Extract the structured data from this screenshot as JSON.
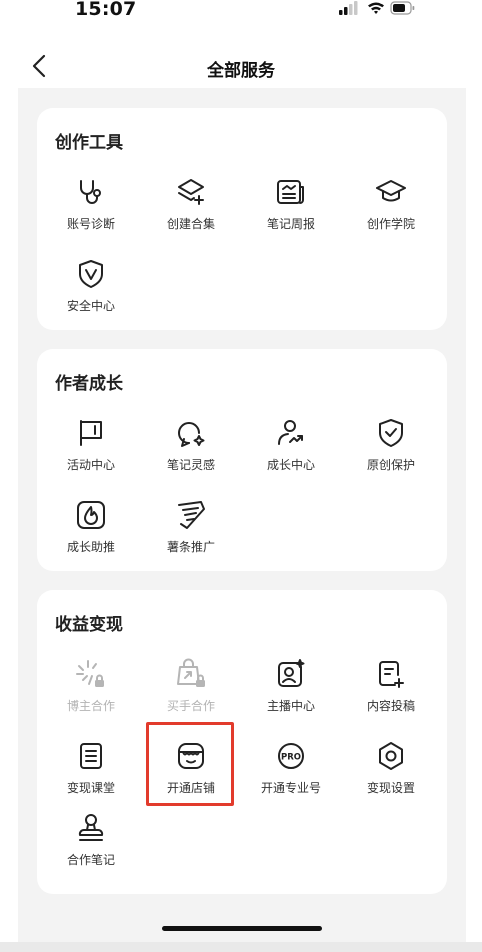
{
  "status_bar": {
    "time": "15:07"
  },
  "nav": {
    "title": "全部服务"
  },
  "sections": [
    {
      "title": "创作工具",
      "items": [
        {
          "label": "账号诊断",
          "icon": "stethoscope-icon"
        },
        {
          "label": "创建合集",
          "icon": "collection-plus-icon"
        },
        {
          "label": "笔记周报",
          "icon": "report-icon"
        },
        {
          "label": "创作学院",
          "icon": "graduation-cap-icon"
        },
        {
          "label": "安全中心",
          "icon": "shield-v-icon"
        }
      ]
    },
    {
      "title": "作者成长",
      "items": [
        {
          "label": "活动中心",
          "icon": "flag-icon"
        },
        {
          "label": "笔记灵感",
          "icon": "bulb-icon"
        },
        {
          "label": "成长中心",
          "icon": "user-growth-icon"
        },
        {
          "label": "原创保护",
          "icon": "shield-check-icon"
        },
        {
          "label": "成长助推",
          "icon": "flame-icon"
        },
        {
          "label": "薯条推广",
          "icon": "fries-icon"
        }
      ]
    },
    {
      "title": "收益变现",
      "items": [
        {
          "label": "博主合作",
          "icon": "sparkle-lock-icon",
          "disabled": true
        },
        {
          "label": "买手合作",
          "icon": "bag-lock-icon",
          "disabled": true
        },
        {
          "label": "主播中心",
          "icon": "live-host-icon"
        },
        {
          "label": "内容投稿",
          "icon": "submit-icon"
        },
        {
          "label": "变现课堂",
          "icon": "course-icon"
        },
        {
          "label": "开通店铺",
          "icon": "store-icon"
        },
        {
          "label": "开通专业号",
          "icon": "pro-badge-icon"
        },
        {
          "label": "变现设置",
          "icon": "gear-icon"
        },
        {
          "label": "合作笔记",
          "icon": "stamp-icon"
        }
      ]
    }
  ]
}
